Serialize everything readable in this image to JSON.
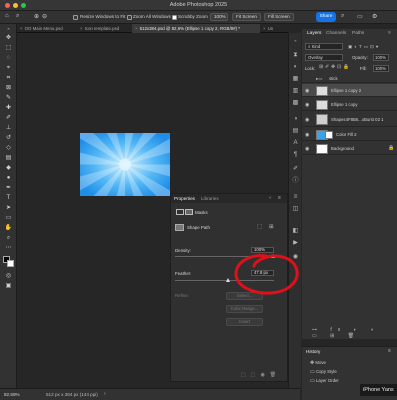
{
  "window": {
    "title": "Adobe Photoshop 2025"
  },
  "options": {
    "resize_windows": "Resize Windows to Fit",
    "zoom_all": "Zoom All Windows",
    "scrubby_zoom": "Scrubby Zoom",
    "zoom_pct": "100%",
    "fit_screen": "Fit Screen",
    "fill_screen": "Fill Screen",
    "share": "Share"
  },
  "tabs": [
    {
      "label": "OO Main Menu.psd"
    },
    {
      "label": "Icon template.psd"
    },
    {
      "label": "512x384.psd @ 82,6% (Ellipse 1 copy 2, RGB/8#) *"
    },
    {
      "label": "Un"
    }
  ],
  "status": {
    "zoom": "82.59%",
    "doc_size": "512 px x 384 px (144 ppi)"
  },
  "layers_panel": {
    "tabs": [
      "Layers",
      "Channels",
      "Paths"
    ],
    "kind": "Kind",
    "blend_mode": "Overlay",
    "opacity_label": "Opacity:",
    "opacity": "100%",
    "lock_label": "Lock:",
    "fill_label": "Fill:",
    "fill": "100%",
    "layers": [
      {
        "name": "stick"
      },
      {
        "name": "Ellipse 1 copy 2"
      },
      {
        "name": "Ellipse 1 copy"
      },
      {
        "name": "Shapes4F8B6...xBurst 02 1"
      },
      {
        "name": "Color Fill 2"
      },
      {
        "name": "Background"
      }
    ]
  },
  "properties": {
    "tabs": [
      "Properties",
      "Libraries"
    ],
    "masks": "Masks",
    "shape_path": "Shape Path",
    "density_label": "Density:",
    "density": "100%",
    "feather_label": "Feather:",
    "feather": "47.8 px",
    "refine_label": "Refine:",
    "select_btn": "Select...",
    "color_range": "Color Range...",
    "invert": "Invert"
  },
  "history": {
    "title": "History",
    "items": [
      "Move",
      "Copy Style",
      "Layer Order"
    ]
  },
  "overlay": {
    "iphone": "iPhone Yans"
  },
  "colors": {
    "accent": "#1473e6",
    "annotation": "#e0101a",
    "burst_light": "#bfe8ff",
    "burst_dark": "#2f9df0"
  }
}
